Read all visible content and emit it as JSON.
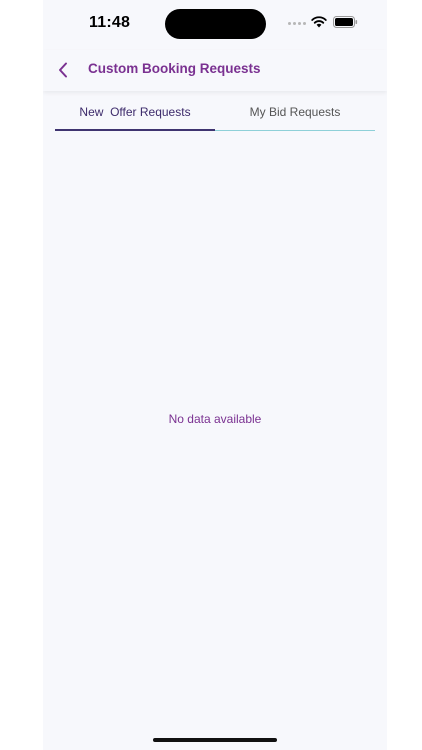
{
  "status_bar": {
    "time": "11:48"
  },
  "header": {
    "title": "Custom Booking Requests",
    "back_icon": "chevron-left-icon"
  },
  "tabs": [
    {
      "label": "New  Offer Requests",
      "active": true
    },
    {
      "label": "My Bid Requests",
      "active": false
    }
  ],
  "content": {
    "empty_message": "No data available"
  },
  "colors": {
    "accent": "#7a3191",
    "active_tab_underline": "#3f3470",
    "inactive_tab_underline": "#8ed0d8",
    "background": "#f7f8fc"
  }
}
